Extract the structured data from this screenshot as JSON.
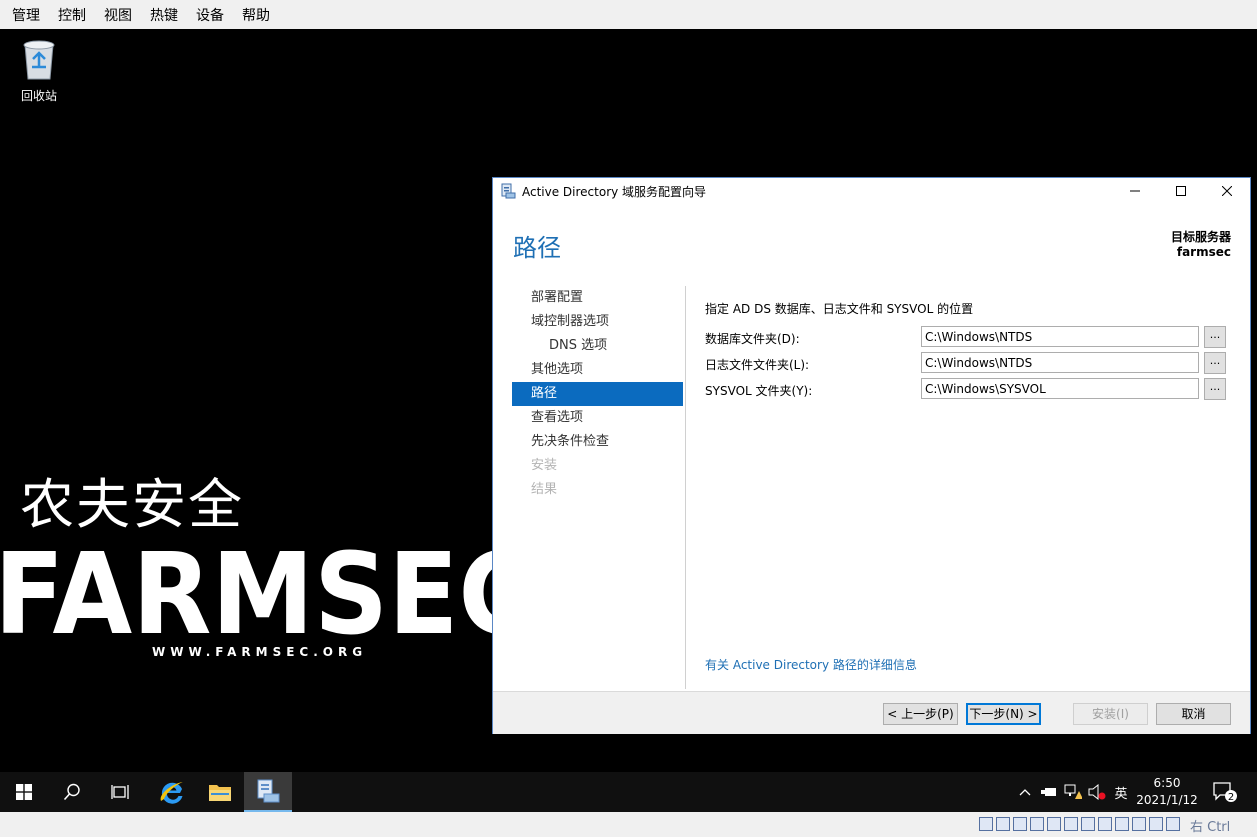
{
  "host_menu": [
    "管理",
    "控制",
    "视图",
    "热键",
    "设备",
    "帮助"
  ],
  "desktop": {
    "recycle_bin_label": "回收站",
    "logo": {
      "chinese": "农夫安全",
      "brand": "FARMSEC",
      "url": "WWW.FARMSEC.ORG"
    }
  },
  "wizard": {
    "title": "Active Directory 域服务配置向导",
    "page_title": "路径",
    "target_server_label": "目标服务器",
    "target_server_name": "farmsec",
    "nav": [
      {
        "label": "部署配置",
        "state": "normal"
      },
      {
        "label": "域控制器选项",
        "state": "normal"
      },
      {
        "label": "DNS 选项",
        "state": "sub"
      },
      {
        "label": "其他选项",
        "state": "normal"
      },
      {
        "label": "路径",
        "state": "selected"
      },
      {
        "label": "查看选项",
        "state": "normal"
      },
      {
        "label": "先决条件检查",
        "state": "normal"
      },
      {
        "label": "安装",
        "state": "disabled"
      },
      {
        "label": "结果",
        "state": "disabled"
      }
    ],
    "instruction": "指定 AD DS 数据库、日志文件和 SYSVOL 的位置",
    "fields": [
      {
        "label": "数据库文件夹(D):",
        "value": "C:\\Windows\\NTDS",
        "browse": "..."
      },
      {
        "label": "日志文件文件夹(L):",
        "value": "C:\\Windows\\NTDS",
        "browse": "..."
      },
      {
        "label": "SYSVOL 文件夹(Y):",
        "value": "C:\\Windows\\SYSVOL",
        "browse": "..."
      }
    ],
    "more_info_link": "有关 Active Directory 路径的详细信息",
    "buttons": {
      "prev": "< 上一步(P)",
      "next": "下一步(N) >",
      "install": "安装(I)",
      "cancel": "取消"
    }
  },
  "taskbar": {
    "ime": "英",
    "time": "6:50",
    "date": "2021/1/12",
    "notification_count": "2"
  },
  "vm_status": {
    "host_key": "右 Ctrl"
  },
  "colors": {
    "accent": "#0b6bbf",
    "title_blue": "#1e6fb4",
    "taskbar": "#101010"
  }
}
